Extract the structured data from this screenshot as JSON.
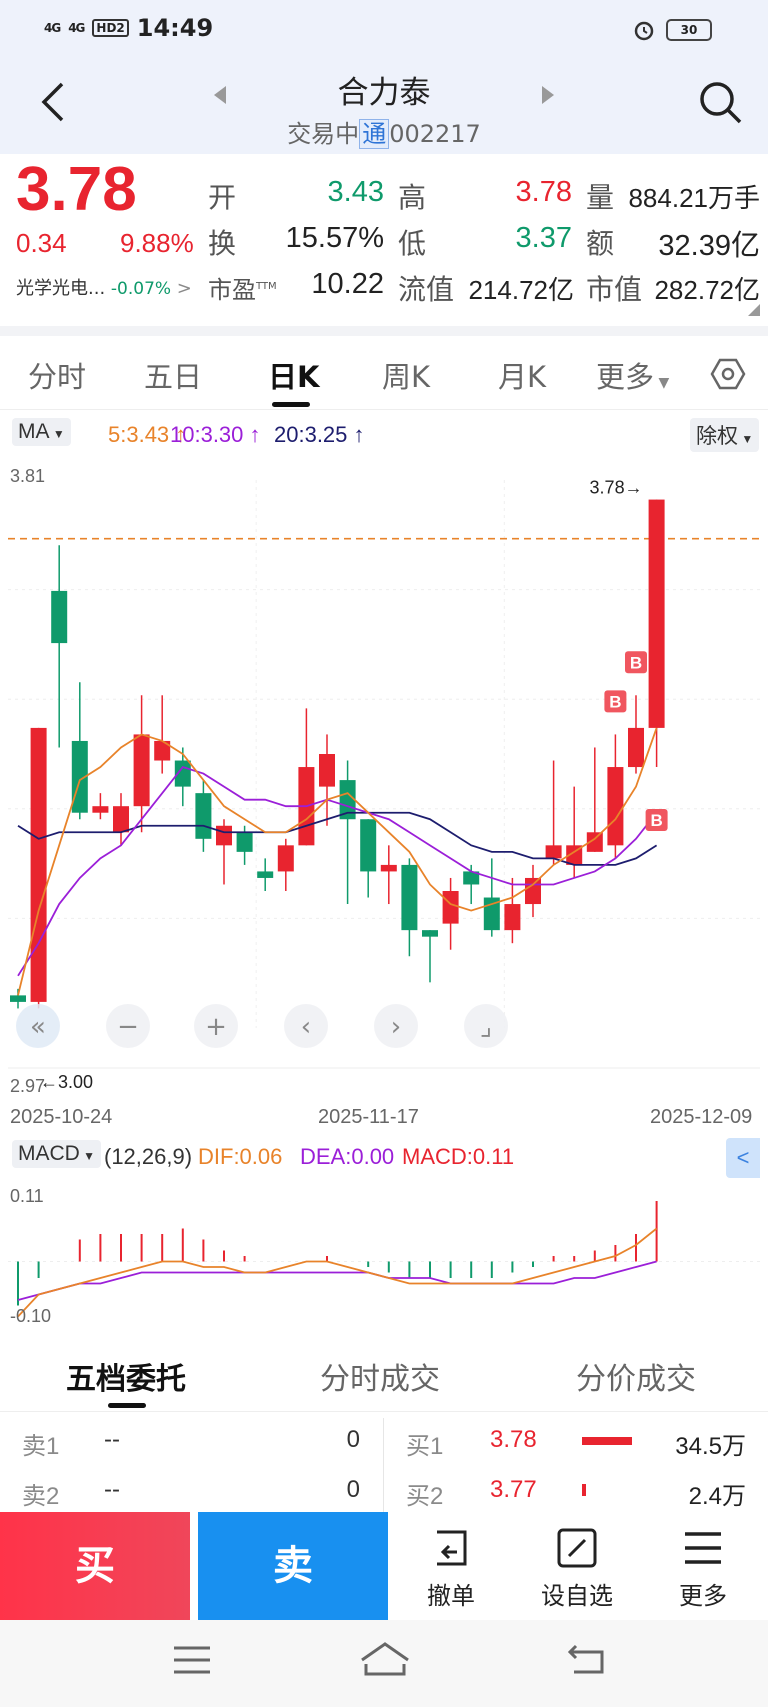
{
  "status_bar": {
    "signal1": "4G",
    "signal2": "4G",
    "hd": "HD2",
    "time": "14:49",
    "battery": "30"
  },
  "header": {
    "stock_name": "合力泰",
    "status": "交易中",
    "tag": "通",
    "code": "002217"
  },
  "quote": {
    "price": "3.78",
    "change": "0.34",
    "change_pct": "9.88%",
    "sector": "光学光电...",
    "sector_pct": "-0.07%",
    "open_label": "开",
    "open": "3.43",
    "high_label": "高",
    "high": "3.78",
    "volume_label": "量",
    "volume": "884.21万手",
    "turnover_label": "换",
    "turnover": "15.57%",
    "low_label": "低",
    "low": "3.37",
    "amount_label": "额",
    "amount": "32.39亿",
    "pe_label": "市盈",
    "pe_sup": "TTM",
    "pe": "10.22",
    "float_cap_label": "流值",
    "float_cap": "214.72亿",
    "mkt_cap_label": "市值",
    "mkt_cap": "282.72亿"
  },
  "tabs": [
    "分时",
    "五日",
    "日K",
    "周K",
    "月K",
    "更多"
  ],
  "active_tab": "日K",
  "ma": {
    "label": "MA",
    "ma5": "5:3.43",
    "ma10": "10:3.30",
    "ma20": "20:3.25",
    "adjust": "除权"
  },
  "chart_data": [
    {
      "type": "candlestick",
      "ylim": [
        2.97,
        3.81
      ],
      "y_top_label": "3.81",
      "y_bottom_label": "2.97",
      "max_label": "3.78→",
      "min_label": "←3.00",
      "dashed_price": 3.72,
      "x_tick_labels": [
        "2025-10-24",
        "2025-11-17",
        "2025-12-09"
      ],
      "candles": [
        {
          "o": 3.02,
          "c": 3.01,
          "h": 3.03,
          "l": 3.0
        },
        {
          "o": 3.01,
          "c": 3.43,
          "h": 3.43,
          "l": 3.0
        },
        {
          "o": 3.64,
          "c": 3.56,
          "h": 3.71,
          "l": 3.4
        },
        {
          "o": 3.41,
          "c": 3.3,
          "h": 3.5,
          "l": 3.29
        },
        {
          "o": 3.3,
          "c": 3.31,
          "h": 3.33,
          "l": 3.29
        },
        {
          "o": 3.27,
          "c": 3.31,
          "h": 3.33,
          "l": 3.25
        },
        {
          "o": 3.31,
          "c": 3.42,
          "h": 3.48,
          "l": 3.27
        },
        {
          "o": 3.38,
          "c": 3.41,
          "h": 3.48,
          "l": 3.36
        },
        {
          "o": 3.38,
          "c": 3.34,
          "h": 3.4,
          "l": 3.31
        },
        {
          "o": 3.33,
          "c": 3.26,
          "h": 3.35,
          "l": 3.24
        },
        {
          "o": 3.25,
          "c": 3.28,
          "h": 3.29,
          "l": 3.19
        },
        {
          "o": 3.27,
          "c": 3.24,
          "h": 3.28,
          "l": 3.22
        },
        {
          "o": 3.21,
          "c": 3.2,
          "h": 3.23,
          "l": 3.18
        },
        {
          "o": 3.21,
          "c": 3.25,
          "h": 3.26,
          "l": 3.18
        },
        {
          "o": 3.25,
          "c": 3.37,
          "h": 3.46,
          "l": 3.25
        },
        {
          "o": 3.34,
          "c": 3.39,
          "h": 3.42,
          "l": 3.28
        },
        {
          "o": 3.35,
          "c": 3.29,
          "h": 3.38,
          "l": 3.16
        },
        {
          "o": 3.29,
          "c": 3.21,
          "h": 3.29,
          "l": 3.17
        },
        {
          "o": 3.21,
          "c": 3.22,
          "h": 3.25,
          "l": 3.16
        },
        {
          "o": 3.22,
          "c": 3.12,
          "h": 3.23,
          "l": 3.08
        },
        {
          "o": 3.12,
          "c": 3.11,
          "h": 3.12,
          "l": 3.04
        },
        {
          "o": 3.13,
          "c": 3.18,
          "h": 3.2,
          "l": 3.09
        },
        {
          "o": 3.21,
          "c": 3.19,
          "h": 3.22,
          "l": 3.16
        },
        {
          "o": 3.17,
          "c": 3.12,
          "h": 3.23,
          "l": 3.11
        },
        {
          "o": 3.12,
          "c": 3.16,
          "h": 3.2,
          "l": 3.1
        },
        {
          "o": 3.16,
          "c": 3.2,
          "h": 3.22,
          "l": 3.14
        },
        {
          "o": 3.23,
          "c": 3.25,
          "h": 3.38,
          "l": 3.22
        },
        {
          "o": 3.22,
          "c": 3.25,
          "h": 3.34,
          "l": 3.2
        },
        {
          "o": 3.24,
          "c": 3.27,
          "h": 3.4,
          "l": 3.24
        },
        {
          "o": 3.25,
          "c": 3.37,
          "h": 3.42,
          "l": 3.23
        },
        {
          "o": 3.37,
          "c": 3.43,
          "h": 3.48,
          "l": 3.36
        },
        {
          "o": 3.43,
          "c": 3.78,
          "h": 3.78,
          "l": 3.37
        }
      ],
      "ma5": [
        3.02,
        3.15,
        3.25,
        3.35,
        3.37,
        3.4,
        3.42,
        3.41,
        3.39,
        3.35,
        3.31,
        3.29,
        3.27,
        3.27,
        3.29,
        3.32,
        3.33,
        3.3,
        3.27,
        3.24,
        3.19,
        3.16,
        3.15,
        3.16,
        3.17,
        3.19,
        3.22,
        3.24,
        3.26,
        3.29,
        3.34,
        3.43
      ],
      "ma10": [
        3.05,
        3.1,
        3.16,
        3.2,
        3.23,
        3.25,
        3.29,
        3.33,
        3.37,
        3.36,
        3.34,
        3.32,
        3.32,
        3.31,
        3.31,
        3.32,
        3.31,
        3.3,
        3.29,
        3.27,
        3.25,
        3.23,
        3.21,
        3.2,
        3.19,
        3.19,
        3.19,
        3.2,
        3.21,
        3.23,
        3.26,
        3.3
      ],
      "ma20": [
        3.28,
        3.26,
        3.27,
        3.27,
        3.27,
        3.27,
        3.28,
        3.28,
        3.28,
        3.28,
        3.27,
        3.27,
        3.27,
        3.27,
        3.28,
        3.29,
        3.3,
        3.3,
        3.3,
        3.3,
        3.29,
        3.27,
        3.25,
        3.24,
        3.24,
        3.23,
        3.23,
        3.22,
        3.22,
        3.22,
        3.23,
        3.25
      ],
      "buy_markers": [
        {
          "index": 29,
          "label": "B"
        },
        {
          "index": 30,
          "label": "B"
        },
        {
          "index": 31,
          "label": "B"
        }
      ]
    },
    {
      "type": "bar",
      "title": "MACD",
      "params": "(12,26,9)",
      "dif_label": "DIF:0.06",
      "dea_label": "DEA:0.00",
      "macd_label": "MACD:0.11",
      "y_top_label": "0.11",
      "y_bottom_label": "-0.10",
      "ylim": [
        -0.11,
        0.13
      ],
      "macd": [
        -0.08,
        -0.03,
        0.0,
        0.04,
        0.05,
        0.05,
        0.05,
        0.05,
        0.06,
        0.04,
        0.02,
        0.01,
        0.0,
        0.0,
        0.0,
        0.01,
        0.0,
        -0.01,
        -0.02,
        -0.03,
        -0.03,
        -0.03,
        -0.03,
        -0.03,
        -0.02,
        -0.01,
        0.01,
        0.01,
        0.02,
        0.03,
        0.05,
        0.11
      ],
      "dif": [
        -0.1,
        -0.06,
        -0.05,
        -0.04,
        -0.03,
        -0.02,
        -0.01,
        0.0,
        0.0,
        -0.01,
        -0.01,
        -0.02,
        -0.02,
        -0.01,
        0.0,
        0.0,
        -0.01,
        -0.02,
        -0.03,
        -0.04,
        -0.04,
        -0.04,
        -0.04,
        -0.04,
        -0.04,
        -0.03,
        -0.02,
        -0.01,
        0.0,
        0.01,
        0.03,
        0.06
      ],
      "dea": [
        -0.07,
        -0.06,
        -0.05,
        -0.04,
        -0.04,
        -0.03,
        -0.02,
        -0.02,
        -0.02,
        -0.02,
        -0.02,
        -0.02,
        -0.02,
        -0.02,
        -0.02,
        -0.02,
        -0.02,
        -0.02,
        -0.03,
        -0.03,
        -0.03,
        -0.04,
        -0.04,
        -0.04,
        -0.04,
        -0.04,
        -0.04,
        -0.03,
        -0.03,
        -0.02,
        -0.01,
        0.0
      ]
    }
  ],
  "orderbook": {
    "tabs": [
      "五档委托",
      "分时成交",
      "分价成交"
    ],
    "sell": [
      {
        "label": "卖1",
        "price": "--",
        "volume": "0"
      },
      {
        "label": "卖2",
        "price": "--",
        "volume": "0"
      }
    ],
    "buy": [
      {
        "label": "买1",
        "price": "3.78",
        "volume": "34.5万",
        "bar_ratio": 1.0
      },
      {
        "label": "买2",
        "price": "3.77",
        "volume": "2.4万",
        "bar_ratio": 0.07
      }
    ]
  },
  "actions": {
    "buy": "买",
    "sell": "卖",
    "cancel": "撤单",
    "watchlist": "设自选",
    "more": "更多"
  },
  "colors": {
    "up": "#e8242f",
    "down": "#0f9a6b",
    "ma5": "#e8832a",
    "ma10": "#9b1fd8",
    "ma20": "#1d1d6e"
  }
}
